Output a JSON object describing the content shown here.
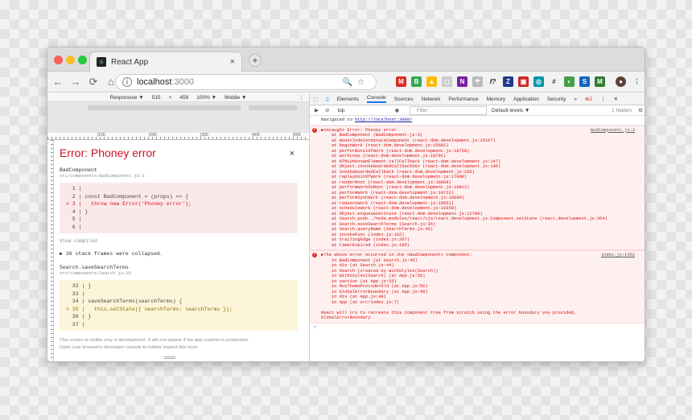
{
  "tab": {
    "title": "React App",
    "close": "×"
  },
  "address": {
    "host": "localhost",
    "port": ":3000"
  },
  "device_toolbar": {
    "device": "Responsive ▼",
    "width": "515",
    "x": "×",
    "height": "459",
    "zoom": "100% ▼",
    "mode": "Mobile ▼"
  },
  "ruler": [
    "|100",
    "|200",
    "|300",
    "|400",
    "|500"
  ],
  "overlay": {
    "title": "Error: Phoney error",
    "close": "×",
    "frame1": {
      "name": "BadComponent",
      "path": "src/components/BadComponent.js:3",
      "lines": [
        "  1 | ",
        "  2 | const BadComponent = (props) => {",
        "> 3 |   throw new Error('Phoney error');",
        "  4 | }",
        "  5 | ",
        "  6 | "
      ]
    },
    "view_compiled": "View compiled",
    "collapsed": "▶ 16 stack frames were collapsed.",
    "frame2": {
      "name": "Search.saveSearchTerms",
      "path": "src/components/Search.js:35",
      "lines": [
        "  32 | }",
        "  33 | ",
        "  34 | saveSearchTerms(searchTerms) {",
        "> 35 |   this.setState({ searchTerms: searchTerms });",
        "  36 | }",
        "  37 | "
      ]
    },
    "note1": "This screen is visible only in development. It will not appear if the app crashes in production.",
    "note2": "Open your browser's developer console to further inspect this error."
  },
  "devtools": {
    "tabs": [
      "Elements",
      "Console",
      "Sources",
      "Network",
      "Performance",
      "Memory",
      "Application",
      "Security",
      "»"
    ],
    "error_count": "2",
    "context": "top",
    "filter_placeholder": "Filter",
    "levels": "Default levels ▼",
    "hidden": "1 hidden",
    "navigated": "Navigated to ",
    "navigated_url": "http://localhost:3000/",
    "error1": {
      "source": "BadComponent.js:3",
      "lines": [
        "▶Uncaught Error: Phoney error",
        "    at BadComponent (BadComponent.js:3)",
        "    at mountIndeterminateComponent (react-dom.development.js:15167)",
        "    at beginWork (react-dom.development.js:15692)",
        "    at performUnitOfWork (react-dom.development.js:18750)",
        "    at workLoop (react-dom.development.js:18791)",
        "    at HTMLUnknownElement.callCallback (react-dom.development.js:147)",
        "    at Object.invokeGuardedCallbackDev (react-dom.development.js:196)",
        "    at invokeGuardedCallback (react-dom.development.js:250)",
        "    at replayUnitOfWork (react-dom.development.js:17998)",
        "    at renderRoot (react-dom.development.js:18909)",
        "    at performWorkOnRoot (react-dom.development.js:19812)",
        "    at performWork (react-dom.development.js:19722)",
        "    at performSyncWork (react-dom.development.js:19696)",
        "    at requestWork (react-dom.development.js:19551)",
        "    at scheduleWork (react-dom.development.js:19358)",
        "    at Object.enqueueSetState (react-dom.development.js:12789)",
        "    at Search.push../node_modules/react/cjs/react.development.js.Component.setState (react.development.js:354)",
        "    at Search.saveSearchTerms (Search.js:35)",
        "    at Search.queryName (SearchTerms.js:46)",
        "    at invokeFunc (index.js:162)",
        "    at trailingEdge (index.js:207)",
        "    at timerExpired (index.js:195)"
      ]
    },
    "error2": {
      "source": "index.js:1452",
      "lines": [
        "▶The above error occurred in the <BadComponent> component:",
        "    in BadComponent (at Search.js:45)",
        "    in div (at Search.js:44)",
        "    in Search (created by WithStyles(Search))",
        "    in WithStyles(Search) (at App.js:56)",
        "    in section (at App.js:55)",
        "    in MuiThemeProviderOld (at App.js:50)",
        "    in GlobalErrorBoundary (at App.js:49)",
        "    in div (at App.js:48)",
        "    in App (at src/index.js:7)",
        "",
        "React will try to recreate this component tree from scratch using the error boundary you provided,",
        "GlobalErrorBoundary."
      ]
    },
    "prompt": "›"
  },
  "colors": {
    "error_red": "#ce1126",
    "console_red": "#ff0000",
    "tab_blue": "#1a73e8"
  }
}
